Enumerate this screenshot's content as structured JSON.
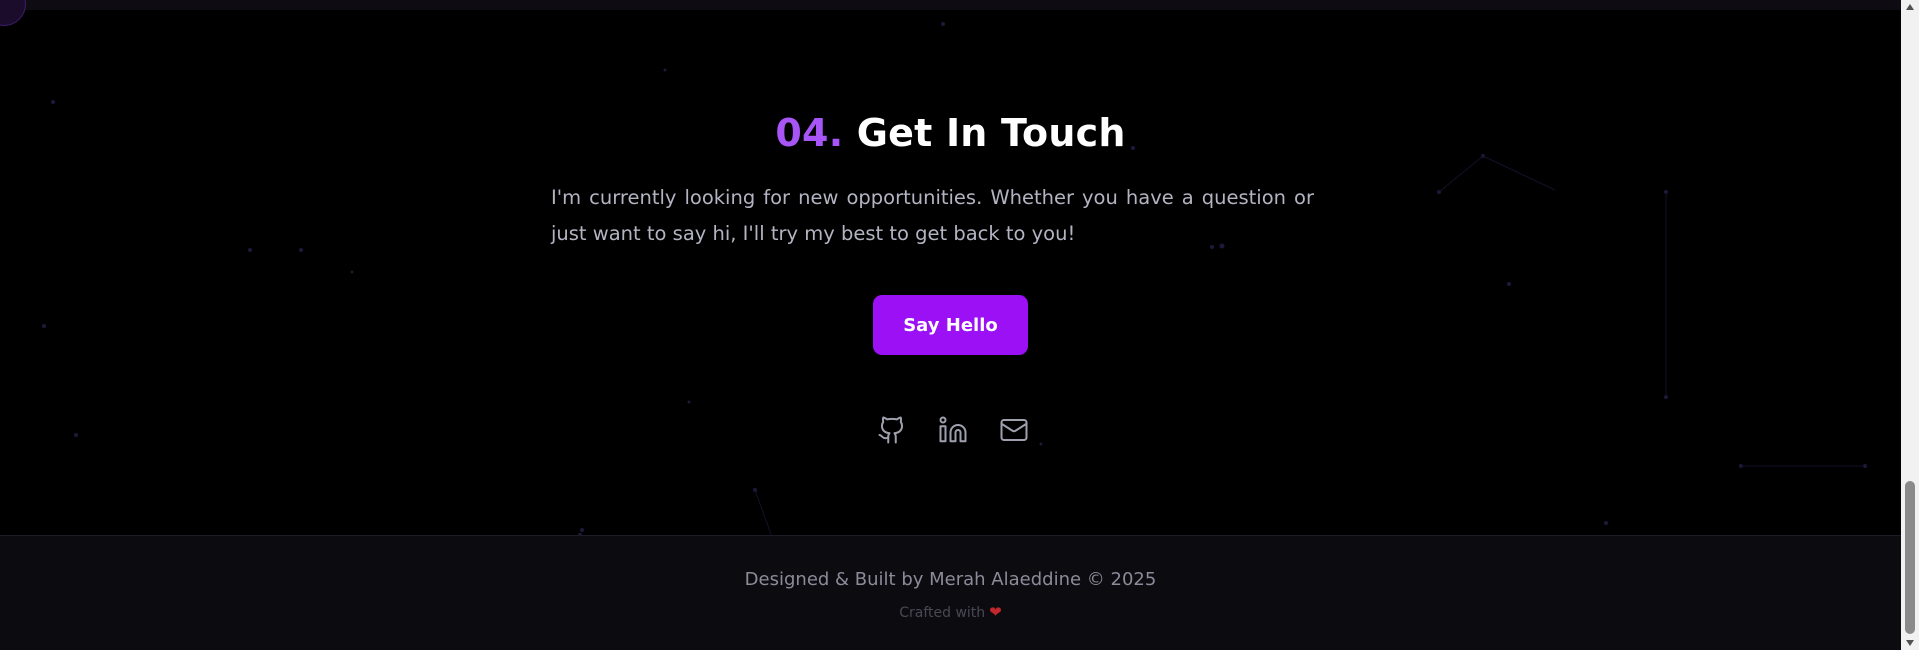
{
  "contact": {
    "number": "04.",
    "title": "Get In Touch",
    "description": "I'm currently looking for new opportunities. Whether you have a question or just want to say hi, I'll try my best to get back to you!",
    "cta_label": "Say Hello"
  },
  "socials": [
    {
      "icon": "github-icon"
    },
    {
      "icon": "linkedin-icon"
    },
    {
      "icon": "mail-icon"
    }
  ],
  "footer": {
    "credit": "Designed & Built by Merah Alaeddine © 2025",
    "crafted": "Crafted with",
    "heart": "❤"
  },
  "colors": {
    "accent": "#a855f7",
    "button": "#9b10f5",
    "background": "#000000",
    "footer_bg": "#0c0b10"
  }
}
